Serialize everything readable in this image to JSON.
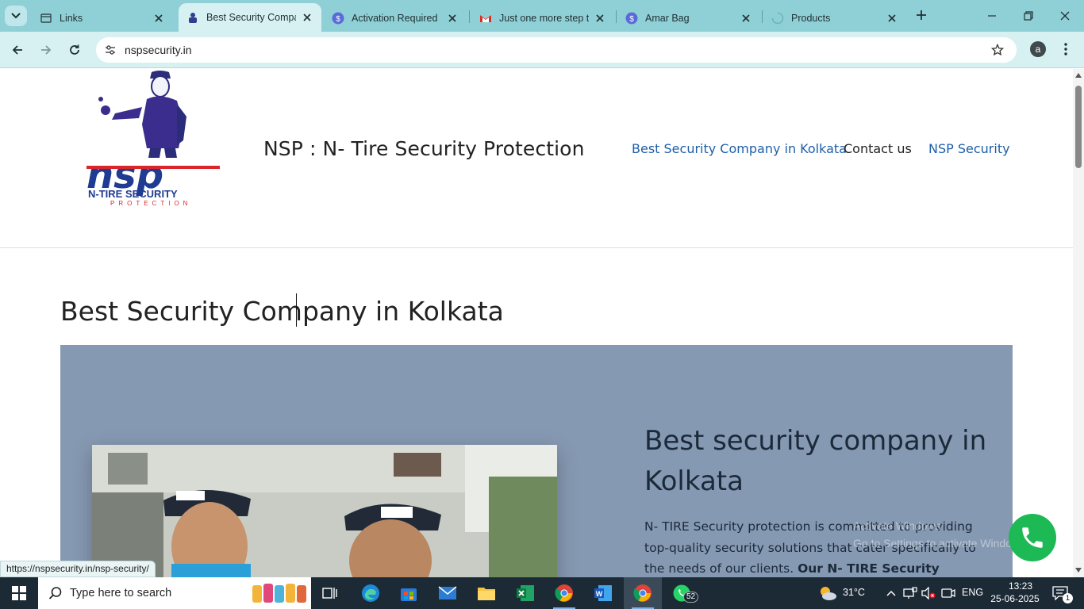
{
  "browser": {
    "tabs": [
      {
        "title": "Links",
        "icon": "page-icon",
        "active": false
      },
      {
        "title": "Best Security Compan",
        "icon": "nsp-favicon",
        "active": true
      },
      {
        "title": "Activation Required",
        "icon": "dollar-icon",
        "active": false
      },
      {
        "title": "Just one more step tc",
        "icon": "gmail-icon",
        "active": false
      },
      {
        "title": "Amar Bag",
        "icon": "dollar-icon",
        "active": false
      },
      {
        "title": "Products",
        "icon": "loading-icon",
        "active": false
      }
    ],
    "address": "nspsecurity.in",
    "profile_initial": "a",
    "status_url": "https://nspsecurity.in/nsp-security/"
  },
  "site": {
    "title": "NSP : N- Tire Security Protection",
    "logo_text_main": "nsp",
    "logo_text_sub": "N-TIRE SECURITY",
    "logo_text_sub2": "PROTECTION",
    "nav": [
      {
        "label": "Best Security Company in Kolkata",
        "style": "link"
      },
      {
        "label": "Contact us",
        "style": "plain"
      },
      {
        "label": "NSP Security",
        "style": "link"
      }
    ]
  },
  "main": {
    "page_title": "Best Security Company in Kolkata",
    "hero": {
      "heading": "Best security company in Kolkata",
      "text_plain": "N- TIRE Security protection is committed to providing top-quality security solutions that cater specifically to the needs of our clients. ",
      "text_bold": "Our N- TIRE Security protection Team is"
    },
    "watermark_line1": "Activate Windows",
    "watermark_line2": "Go to Settings to activate Windows."
  },
  "taskbar": {
    "search_placeholder": "Type here to search",
    "whatsapp_badge": "52",
    "weather_temp": "31°C",
    "language": "ENG",
    "time": "13:23",
    "date": "25-06-2025",
    "notification_count": "1"
  },
  "colors": {
    "tabbar": "#8fd0d6",
    "toolbar": "#d7f1f3",
    "nav_link": "#1e5fa8",
    "hero_bg": "#8699b2",
    "whatsapp_green": "#1db954",
    "taskbar": "#1c2a36"
  }
}
